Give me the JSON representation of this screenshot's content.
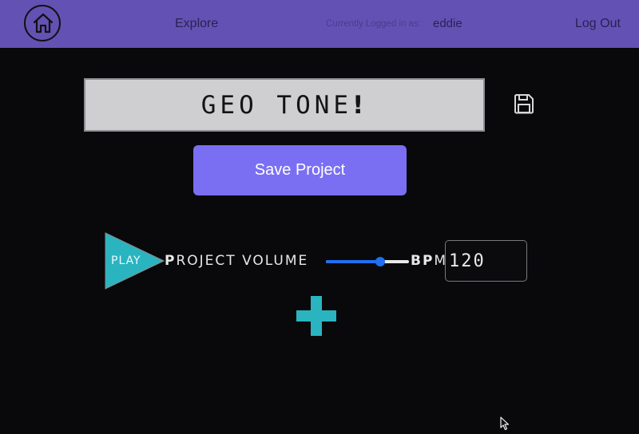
{
  "navbar": {
    "home_icon": "home-icon",
    "explore_label": "Explore",
    "logged_in_label": "Currently Logged in as:",
    "username": "eddie",
    "logout_label": "Log Out",
    "background_color": "#6352b3"
  },
  "project": {
    "title_text": "GEO TONE",
    "title_exclaim": "!",
    "save_icon": "floppy-disk-icon",
    "save_button_label": "Save Project",
    "save_button_color": "#7a6ff3"
  },
  "controls": {
    "play_label": "PLAY",
    "play_color": "#2ab4c0",
    "project_volume_cap1": "P",
    "project_volume_rest1": "ROJECT ",
    "project_volume_cap2": "V",
    "project_volume_rest2": "OLUME",
    "volume_fraction": 0.65,
    "bpm_cap": "BP",
    "bpm_rest": "M",
    "bpm_value": "120",
    "add_icon": "plus-icon",
    "add_color": "#2ab4c0"
  },
  "cursor": {
    "icon": "mouse-pointer-icon"
  }
}
